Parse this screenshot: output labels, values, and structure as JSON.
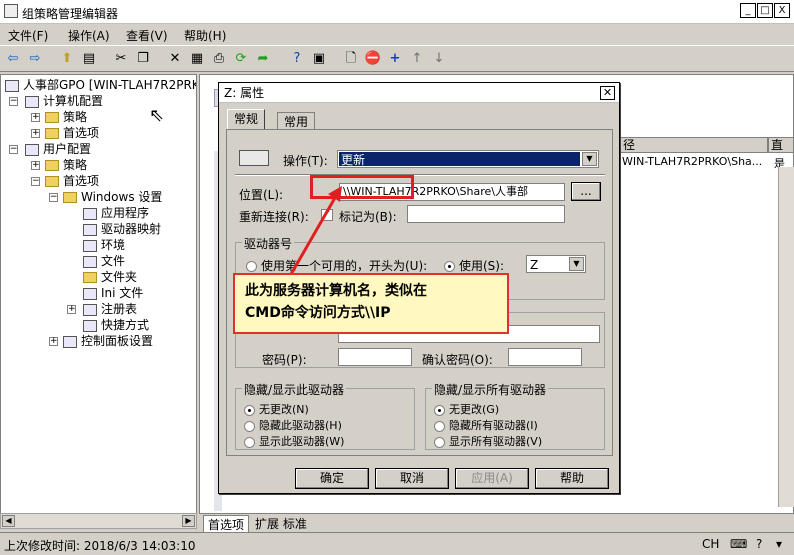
{
  "window": {
    "title": "组策略管理编辑器",
    "controls": [
      "_",
      "□",
      "X"
    ]
  },
  "menu": [
    "文件(F)",
    "操作(A)",
    "查看(V)",
    "帮助(H)"
  ],
  "toolbar_icons": [
    "back-icon",
    "forward-icon",
    "up-icon",
    "show-hide-tree-icon",
    "cut-icon",
    "copy-icon",
    "delete-icon",
    "properties-icon",
    "print-icon",
    "refresh-icon",
    "export-icon",
    "help-icon",
    "view-icon",
    "new-icon",
    "stop-icon",
    "add-icon",
    "move-up-icon",
    "move-down-icon"
  ],
  "tree": {
    "root": "人事部GPO [WIN-TLAH7R2PRKO.T",
    "computer": "计算机配置",
    "policy1": "策略",
    "pref1": "首选项",
    "user": "用户配置",
    "policy2": "策略",
    "pref2": "首选项",
    "winsettings": "Windows 设置",
    "apps": "应用程序",
    "drivemaps": "驱动器映射",
    "env": "环境",
    "files": "文件",
    "folders": "文件夹",
    "ini": "Ini 文件",
    "registry": "注册表",
    "shortcuts": "快捷方式",
    "control": "控制面板设置"
  },
  "rightpane": {
    "col_path": "径",
    "col_extra": "直",
    "row_path": "WIN-TLAH7R2PRKO\\Sha...",
    "row_extra": "是"
  },
  "tabs": {
    "pref": "首选项",
    "ext": "扩展",
    "std": "标准"
  },
  "status": {
    "modified": "上次修改时间: 2018/6/3 14:03:10",
    "ime": "CH"
  },
  "dialog": {
    "title": "Z: 属性",
    "tab_general": "常规",
    "tab_common": "常用",
    "action_label": "操作(T):",
    "action_value": "更新",
    "location_label": "位置(L):",
    "location_value": "\\\\WIN-TLAH7R2PRKO\\Share\\人事部",
    "browse": "...",
    "reconnect_label": "重新连接(R):",
    "label_as": "标记为(B):",
    "label_value": "",
    "drive_group": "驱动器号",
    "first_available": "使用第一个可用的，开头为(U):",
    "use": "使用(S):",
    "drive_letter": "Z",
    "password_label": "密码(P):",
    "confirm_label": "确认密码(O):",
    "hide_this_group": "隐藏/显示此驱动器",
    "hide_all_group": "隐藏/显示所有驱动器",
    "no_change_n": "无更改(N)",
    "hide_this": "隐藏此驱动器(H)",
    "show_this": "显示此驱动器(W)",
    "no_change_g": "无更改(G)",
    "hide_all": "隐藏所有驱动器(I)",
    "show_all": "显示所有驱动器(V)",
    "ok": "确定",
    "cancel": "取消",
    "apply": "应用(A)",
    "help": "帮助"
  },
  "callout": {
    "line1": "此为服务器计算机名，类似在",
    "line2": "CMD命令访问方式\\\\IP"
  },
  "colors": {
    "highlight": "#0a246a",
    "annotation_red": "#e03030",
    "callout_bg": "#fff8c0"
  }
}
